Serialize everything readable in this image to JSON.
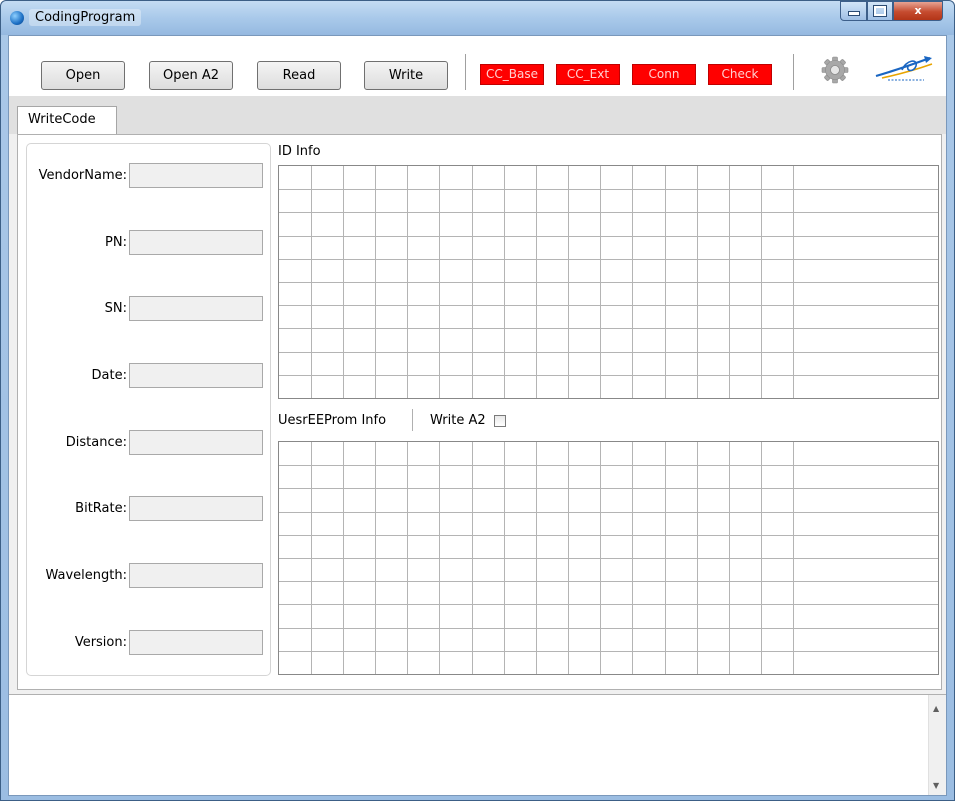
{
  "window": {
    "title": "CodingProgram",
    "minimize": "minimize",
    "maximize": "maximize",
    "close_label": "x"
  },
  "toolbar": {
    "open_label": "Open",
    "open_a2_label": "Open A2",
    "read_label": "Read",
    "write_label": "Write",
    "indicators": [
      "CC_Base",
      "CC_Ext",
      "Conn",
      "Check"
    ],
    "indicator_color": "#ff0000",
    "settings_icon": "gear-icon",
    "logo_icon": "company-logo"
  },
  "tabs": [
    {
      "label": "WriteCode",
      "active": true
    }
  ],
  "fields": [
    {
      "label": "VendorName:",
      "value": ""
    },
    {
      "label": "PN:",
      "value": ""
    },
    {
      "label": "SN:",
      "value": ""
    },
    {
      "label": "Date:",
      "value": ""
    },
    {
      "label": "Distance:",
      "value": ""
    },
    {
      "label": "BitRate:",
      "value": ""
    },
    {
      "label": "Wavelength:",
      "value": ""
    },
    {
      "label": "Version:",
      "value": ""
    }
  ],
  "id_info": {
    "title": "ID Info"
  },
  "user_eeprom": {
    "title": "UesrEEProm Info",
    "write_a2_label": "Write A2",
    "write_a2_checked": false
  },
  "log": {
    "text": ""
  }
}
